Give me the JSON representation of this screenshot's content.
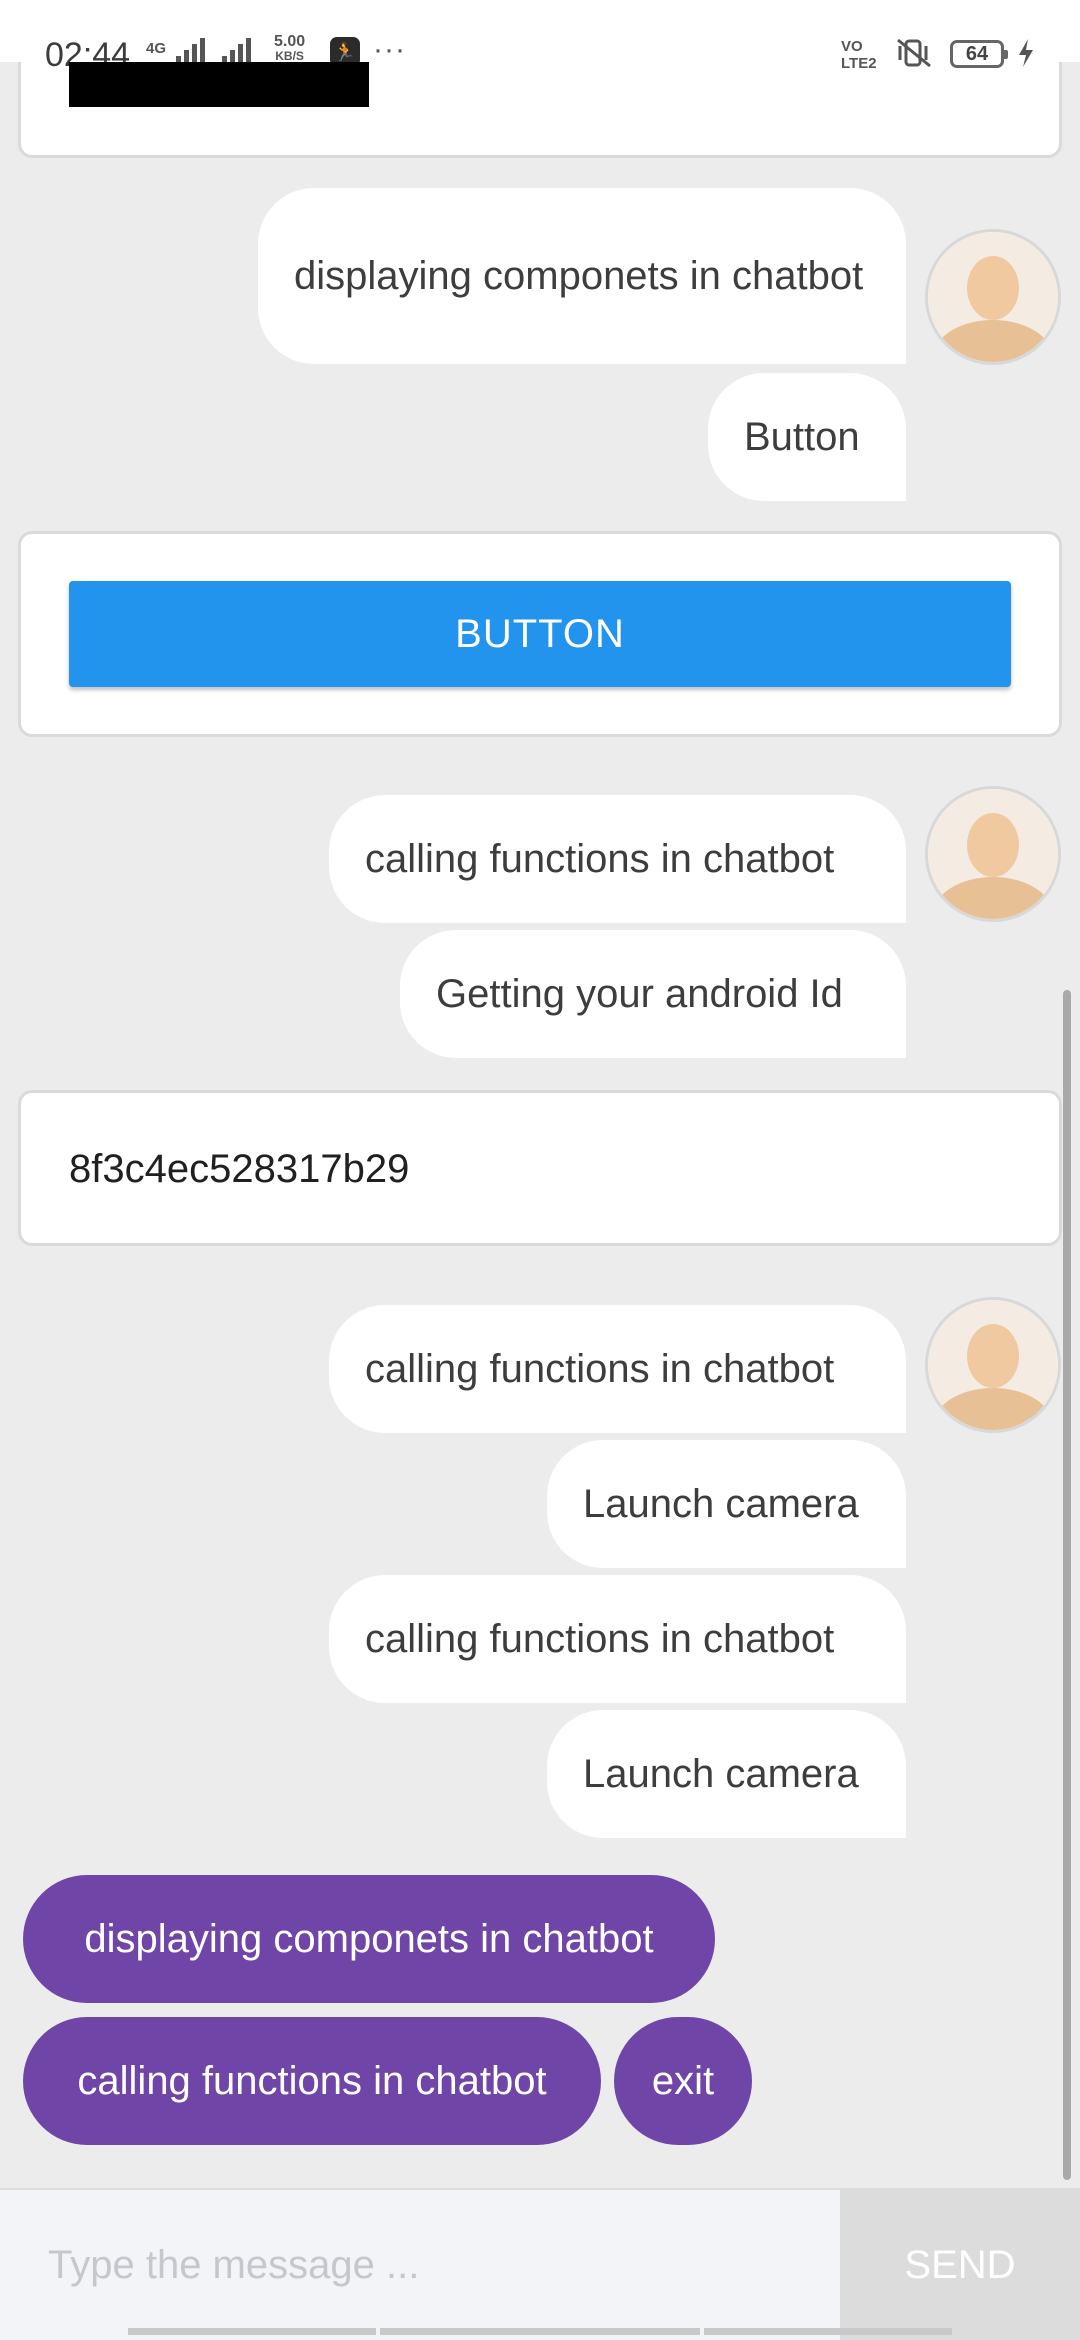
{
  "status_bar": {
    "time": "02:44",
    "network": "4G",
    "speed_value": "5.00",
    "speed_unit": "KB/S",
    "app_icon": "running-figure-icon",
    "more": "···",
    "volte": "VoLTE2",
    "battery": "64",
    "icons": [
      "signal-icon",
      "mute-vibrate-icon",
      "battery-icon",
      "charging-bolt-icon"
    ]
  },
  "chat": {
    "bubbles": [
      {
        "text": "displaying componets in chatbot"
      },
      {
        "text": "Button"
      },
      {
        "text": "calling functions in chatbot"
      },
      {
        "text": "Getting your android Id"
      },
      {
        "text": "calling functions in chatbot"
      },
      {
        "text": "Launch camera"
      },
      {
        "text": "calling functions in chatbot"
      },
      {
        "text": "Launch camera"
      }
    ],
    "button_card": {
      "label": "BUTTON"
    },
    "id_card": {
      "value": "8f3c4ec528317b29"
    },
    "avatar_icon": "user-avatar-icon"
  },
  "quick_replies": [
    {
      "label": "displaying componets in chatbot"
    },
    {
      "label": "calling functions in chatbot"
    },
    {
      "label": "exit"
    }
  ],
  "input_bar": {
    "placeholder": "Type the message ...",
    "send_label": "SEND"
  },
  "colors": {
    "background": "#ececec",
    "button_blue": "#2394ee",
    "chip_purple": "#6f46a8",
    "send_grey": "#dcdcdc"
  }
}
